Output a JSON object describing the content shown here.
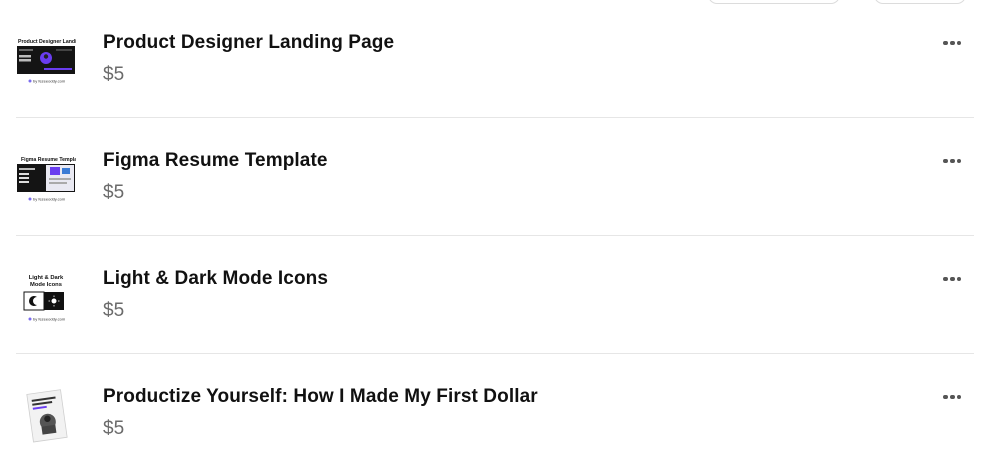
{
  "products": [
    {
      "title": "Product Designer Landing Page",
      "price": "$5",
      "thumb_icon": "landing-page-thumbnail",
      "thumb_text": "Product Designer Landing Page",
      "thumb_footer": "by fezeeoddy.com"
    },
    {
      "title": "Figma Resume Template",
      "price": "$5",
      "thumb_icon": "resume-template-thumbnail",
      "thumb_text": "Figma Resume Template",
      "thumb_footer": "by fezeeoddy.com"
    },
    {
      "title": "Light & Dark Mode Icons",
      "price": "$5",
      "thumb_icon": "light-dark-icons-thumbnail",
      "thumb_text": "Light & Dark Mode Icons",
      "thumb_footer": "by fezeeoddy.com"
    },
    {
      "title": "Productize Yourself: How I Made My First Dollar",
      "price": "$5",
      "thumb_icon": "ebook-cover-thumbnail",
      "thumb_footer": ""
    }
  ],
  "accent_color": "#6a3df0"
}
